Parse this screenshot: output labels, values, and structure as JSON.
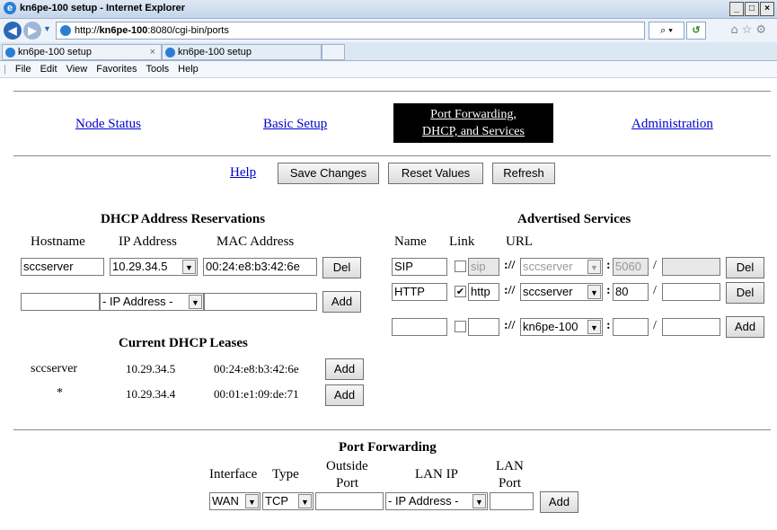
{
  "browser": {
    "window_title": "kn6pe-100 setup - Internet Explorer",
    "url_prefix": "http://",
    "url_host": "kn6pe-100",
    "url_rest": ":8080/cgi-bin/ports",
    "url_controls": "⌕ ▾",
    "tabs": [
      {
        "label": "kn6pe-100 setup"
      },
      {
        "label": "kn6pe-100 setup"
      }
    ],
    "tab_close": "×",
    "toolbar_icons": "⌂☆⚙",
    "menu": [
      "File",
      "Edit",
      "View",
      "Favorites",
      "Tools",
      "Help"
    ],
    "window_buttons": [
      "_",
      "□",
      "×"
    ]
  },
  "nav": {
    "node_status": "Node Status",
    "basic_setup": "Basic Setup",
    "port_forwarding_line1": "Port Forwarding,",
    "port_forwarding_line2": "DHCP, and Services",
    "administration": "Administration"
  },
  "actions": {
    "help": "Help",
    "save": "Save Changes",
    "reset": "Reset Values",
    "refresh": "Refresh"
  },
  "dhcp_reservations": {
    "title": "DHCP Address Reservations",
    "headers": [
      "Hostname",
      "IP Address",
      "MAC Address"
    ],
    "row": {
      "hostname": "sccserver",
      "ip": "10.29.34.5",
      "mac": "00:24:e8:b3:42:6e",
      "button": "Del"
    },
    "new_row": {
      "hostname": "",
      "ip": "- IP Address -",
      "mac": "",
      "button": "Add"
    }
  },
  "dhcp_leases": {
    "title": "Current DHCP Leases",
    "rows": [
      {
        "host": "sccserver",
        "ip": "10.29.34.5",
        "mac": "00:24:e8:b3:42:6e",
        "button": "Add"
      },
      {
        "host": "*",
        "ip": "10.29.34.4",
        "mac": "00:01:e1:09:de:71",
        "button": "Add"
      }
    ]
  },
  "services": {
    "title": "Advertised Services",
    "headers": [
      "Name",
      "Link",
      "URL"
    ],
    "rows": [
      {
        "name": "SIP",
        "checked": false,
        "proto": "sip",
        "host": "sccserver",
        "port": "5060",
        "path": "",
        "button": "Del",
        "disabled": true
      },
      {
        "name": "HTTP",
        "checked": true,
        "proto": "http",
        "host": "sccserver",
        "port": "80",
        "path": "",
        "button": "Del",
        "disabled": false
      },
      {
        "name": "",
        "checked": false,
        "proto": "",
        "host": "kn6pe-100",
        "port": "",
        "path": "",
        "button": "Add",
        "disabled": false
      }
    ],
    "sep_scheme": "://",
    "sep_port": ":",
    "sep_path": "/",
    "check_mark": "✔"
  },
  "port_forwarding": {
    "title": "Port Forwarding",
    "headers": {
      "interface": "Interface",
      "type": "Type",
      "outside1": "Outside",
      "outside2": "Port",
      "lanip": "LAN IP",
      "lanport1": "LAN",
      "lanport2": "Port"
    },
    "row": {
      "interface": "WAN",
      "type": "TCP",
      "outside": "",
      "lanip": "- IP Address -",
      "lanport": "",
      "button": "Add"
    }
  }
}
